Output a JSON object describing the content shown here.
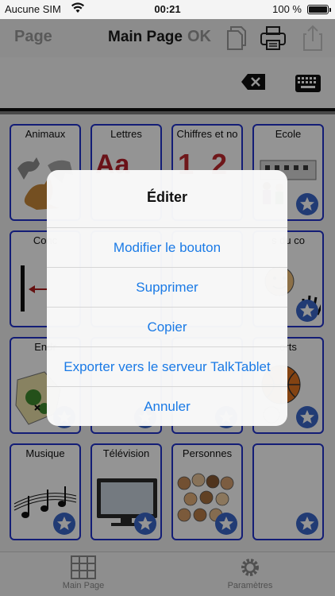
{
  "status_bar": {
    "carrier": "Aucune SIM",
    "time": "00:21",
    "battery_pct": "100 %",
    "battery_level": 1.0
  },
  "toolbar": {
    "page_label": "Page",
    "title": "Main Page",
    "ok_label": "OK"
  },
  "grid": {
    "cells": [
      {
        "label": "Animaux",
        "icon": "animals-picture"
      },
      {
        "label": "Lettres",
        "icon": "letters-picture",
        "glyph": "Aa"
      },
      {
        "label": "Chiffres et no",
        "icon": "numbers-picture",
        "glyph": "1 2"
      },
      {
        "label": "Ecole",
        "icon": "school-picture"
      },
      {
        "label": "Conc",
        "icon": "concept-picture"
      },
      {
        "label": "",
        "icon": "blank"
      },
      {
        "label": "",
        "icon": "blank"
      },
      {
        "label": "s du co",
        "icon": "face-hand-picture"
      },
      {
        "label": "Endr",
        "icon": "map-picture"
      },
      {
        "label": "",
        "icon": "blank"
      },
      {
        "label": "",
        "icon": "blank"
      },
      {
        "label": "orts",
        "icon": "ball-picture"
      },
      {
        "label": "Musique",
        "icon": "music-picture"
      },
      {
        "label": "Télévision",
        "icon": "tv-picture"
      },
      {
        "label": "Personnes",
        "icon": "people-picture"
      },
      {
        "label": "",
        "icon": "blank"
      }
    ]
  },
  "alert": {
    "title": "Éditer",
    "buttons": [
      "Modifier le bouton",
      "Supprimer",
      "Copier",
      "Exporter vers le serveur TalkTablet",
      "Annuler"
    ]
  },
  "tab_bar": {
    "items": [
      {
        "label": "Main Page",
        "icon": "grid-icon"
      },
      {
        "label": "Paramètres",
        "icon": "gear-icon"
      }
    ]
  },
  "colors": {
    "cell_border": "#2233cc",
    "alert_button": "#1a7ae6",
    "star_badge": "#3a66c8"
  }
}
